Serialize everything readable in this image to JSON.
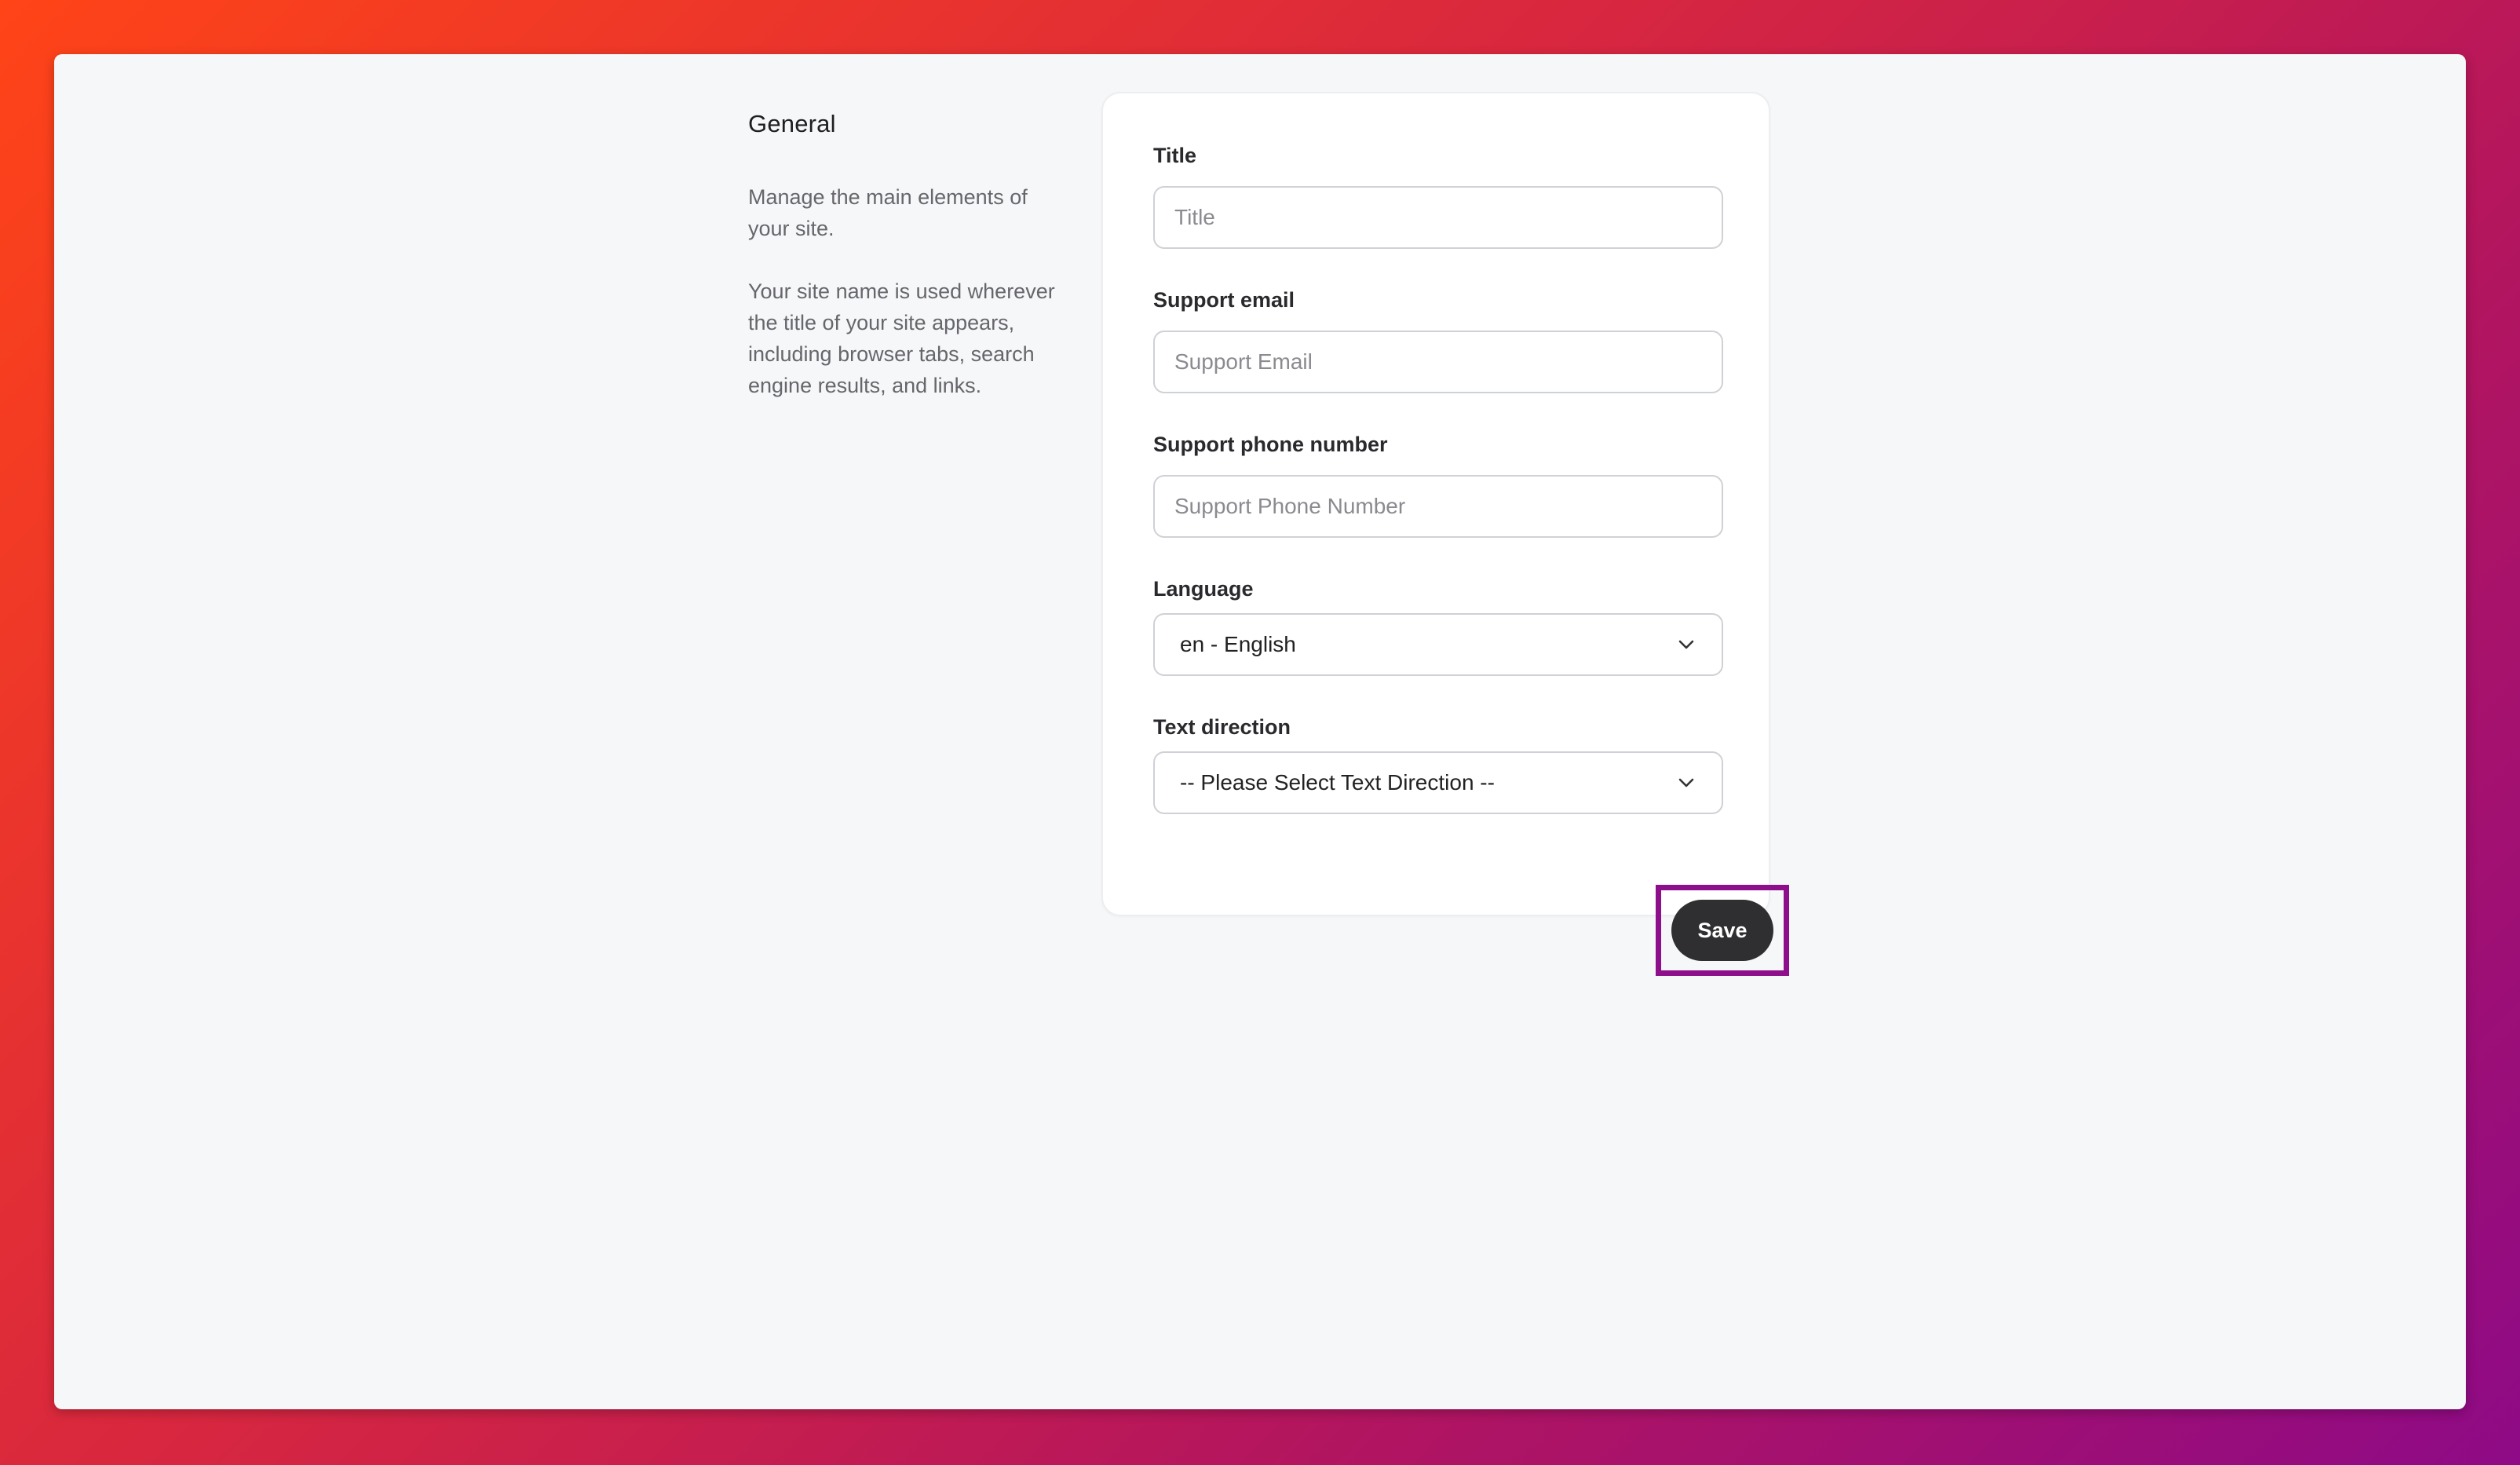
{
  "section": {
    "title": "General",
    "description_1": "Manage the main elements of your site.",
    "description_2": "Your site name is used wherever the title of your site appears, including browser tabs, search engine results, and links."
  },
  "form": {
    "title": {
      "label": "Title",
      "placeholder": "Title",
      "value": ""
    },
    "support_email": {
      "label": "Support email",
      "placeholder": "Support Email",
      "value": ""
    },
    "support_phone": {
      "label": "Support phone number",
      "placeholder": "Support Phone Number",
      "value": ""
    },
    "language": {
      "label": "Language",
      "selected": "en - English",
      "icon": "chevron-down-icon"
    },
    "text_direction": {
      "label": "Text direction",
      "selected": "-- Please Select Text Direction --",
      "icon": "chevron-down-icon"
    }
  },
  "actions": {
    "save_label": "Save",
    "highlight_color": "#8d0f8b"
  },
  "colors": {
    "background_gradient_start": "#ff4417",
    "background_gradient_end": "#8e0a86",
    "button_bg": "#2f2f31",
    "panel_bg": "#f6f7f9"
  }
}
